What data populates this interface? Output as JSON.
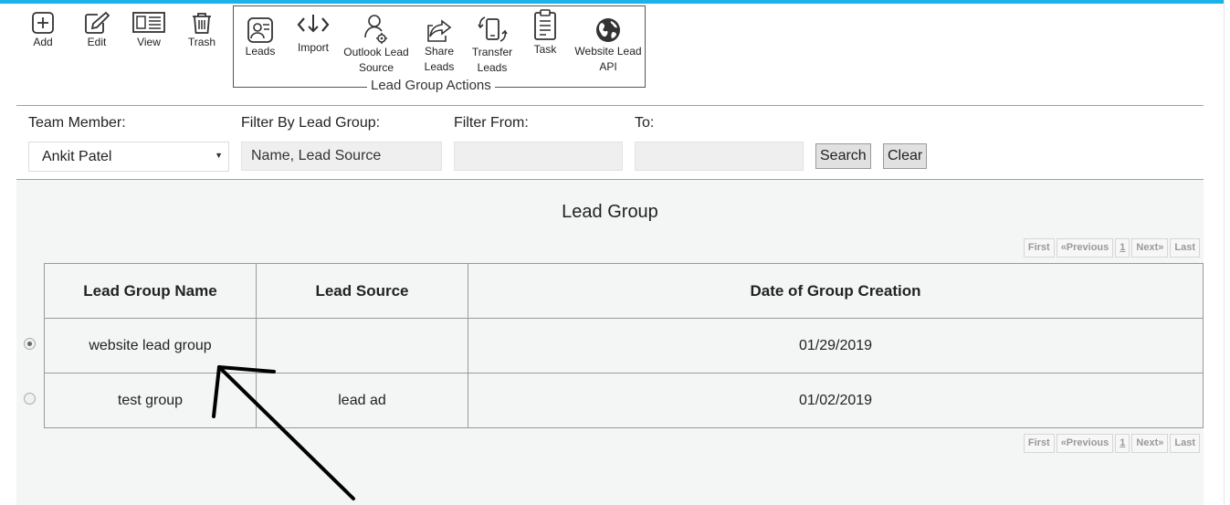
{
  "toolbar": {
    "add": "Add",
    "edit": "Edit",
    "view": "View",
    "trash": "Trash"
  },
  "group_actions": {
    "legend": "Lead Group Actions",
    "leads": "Leads",
    "import": "Import",
    "outlook_1": "Outlook Lead",
    "outlook_2": "Source",
    "share_1": "Share",
    "share_2": "Leads",
    "transfer_1": "Transfer",
    "transfer_2": "Leads",
    "task": "Task",
    "website_1": "Website Lead",
    "website_2": "API"
  },
  "filters": {
    "team_member_label": "Team Member:",
    "team_member_value": "Ankit Patel",
    "lead_group_label": "Filter By Lead Group:",
    "lead_group_placeholder": "Name, Lead Source",
    "from_label": "Filter From:",
    "to_label": "To:",
    "search": "Search",
    "clear": "Clear"
  },
  "panel": {
    "title": "Lead Group"
  },
  "pager": {
    "first": "First",
    "previous": "«Previous",
    "page": "1",
    "next": "Next»",
    "last": "Last"
  },
  "table": {
    "headers": [
      "Lead Group Name",
      "Lead Source",
      "Date of Group Creation"
    ],
    "rows": [
      {
        "name": "website lead group",
        "source": "",
        "date": "01/29/2019",
        "selected": true
      },
      {
        "name": "test group",
        "source": "lead ad",
        "date": "01/02/2019",
        "selected": false
      }
    ]
  },
  "colors": {
    "accent_bar": "#1ab2e8",
    "panel_bg": "#f4f6f5"
  }
}
